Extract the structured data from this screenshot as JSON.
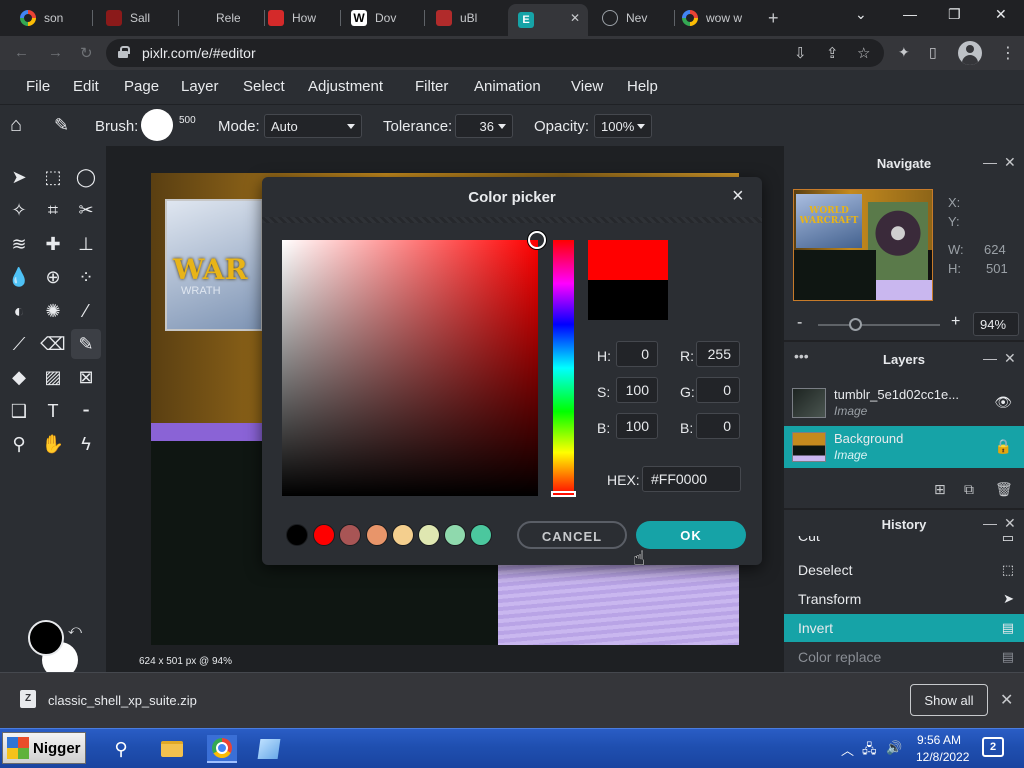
{
  "browser": {
    "tabs": [
      {
        "title": "son",
        "favicon": "google-icon"
      },
      {
        "title": "Sall",
        "favicon": "site-icon"
      },
      {
        "title": "Rele",
        "favicon": "site-icon"
      },
      {
        "title": "How",
        "favicon": "site-icon"
      },
      {
        "title": "Dov",
        "favicon": "w-icon"
      },
      {
        "title": "uBl",
        "favicon": "ublock-icon"
      },
      {
        "title": "",
        "favicon": "pixlr-icon"
      },
      {
        "title": "Nev",
        "favicon": "newtab-icon"
      },
      {
        "title": "wow w",
        "favicon": "google-icon"
      }
    ],
    "url": "pixlr.com/e/#editor"
  },
  "pixlr": {
    "menu": [
      "File",
      "Edit",
      "Page",
      "Layer",
      "Select",
      "Adjustment",
      "Filter",
      "Animation",
      "View",
      "Help"
    ],
    "options": {
      "brush_label": "Brush:",
      "brush_size": "500",
      "mode_label": "Mode:",
      "mode_value": "Auto",
      "tolerance_label": "Tolerance:",
      "tolerance_value": "36",
      "opacity_label": "Opacity:",
      "opacity_value": "100%"
    },
    "canvas_art_text": {
      "title": "WAR",
      "sub": "WRATH"
    },
    "status": "624 x 501 px @ 94%",
    "navigate": {
      "title": "Navigate",
      "thumb_text": "WORLD WARCRAFT",
      "x_label": "X:",
      "y_label": "Y:",
      "w_label": "W:",
      "w_value": "624",
      "h_label": "H:",
      "h_value": "501",
      "zoom_minus": "-",
      "zoom_plus": "+",
      "zoom_value": "94%",
      "zoom_fraction": 0.3
    },
    "layers": {
      "title": "Layers",
      "items": [
        {
          "name": "tumblr_5e1d02cc1e...",
          "type": "Image"
        },
        {
          "name": "Background",
          "type": "Image"
        }
      ]
    },
    "history": {
      "title": "History",
      "items": [
        "Cut",
        "Deselect",
        "Transform",
        "Invert",
        "Color replace"
      ]
    }
  },
  "color_picker": {
    "title": "Color picker",
    "h_label": "H:",
    "h": "0",
    "s_label": "S:",
    "s": "100",
    "b_label": "B:",
    "b": "100",
    "r_label": "R:",
    "r": "255",
    "g_label": "G:",
    "g": "0",
    "bb_label": "B:",
    "bb": "0",
    "hex_label": "HEX:",
    "hex": "#FF0000",
    "swatches": [
      "#000000",
      "#ff0000",
      "#a85555",
      "#e8956a",
      "#f4cf8e",
      "#dfe7b1",
      "#8fd9ad",
      "#4bc79e"
    ],
    "cancel_label": "CANCEL",
    "ok_label": "OK"
  },
  "downloads": {
    "file": "classic_shell_xp_suite.zip",
    "show_all": "Show all"
  },
  "taskbar": {
    "start_label": "Nigger",
    "time": "9:56 AM",
    "date": "12/8/2022",
    "notifications": "2"
  }
}
